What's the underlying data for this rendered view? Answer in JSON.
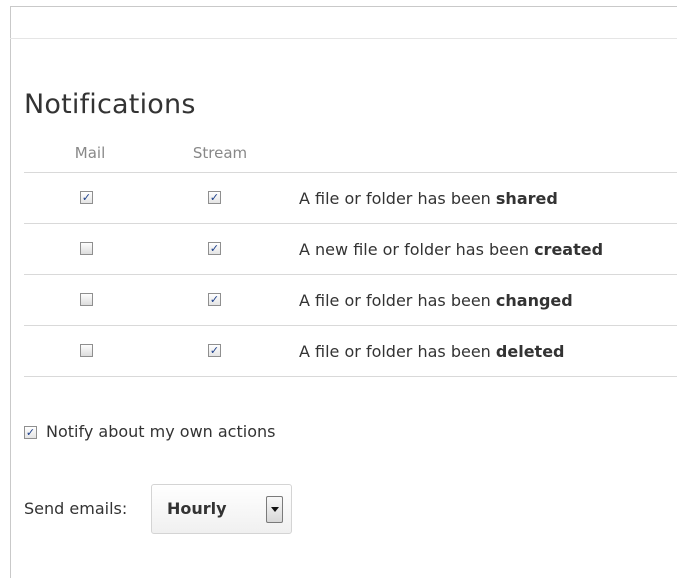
{
  "section": {
    "title": "Notifications",
    "columns": {
      "mail": "Mail",
      "stream": "Stream"
    }
  },
  "rows": [
    {
      "prefix": "A file or folder has been ",
      "emphasis": "shared",
      "mail": true,
      "stream": true
    },
    {
      "prefix": "A new file or folder has been ",
      "emphasis": "created",
      "mail": false,
      "stream": true
    },
    {
      "prefix": "A file or folder has been ",
      "emphasis": "changed",
      "mail": false,
      "stream": true
    },
    {
      "prefix": "A file or folder has been ",
      "emphasis": "deleted",
      "mail": false,
      "stream": true
    }
  ],
  "own_actions": {
    "label": "Notify about my own actions",
    "checked": true
  },
  "send_emails": {
    "label": "Send emails:",
    "value": "Hourly"
  },
  "icons": {
    "checkbox_tick": "checkmark-icon",
    "select_arrow": "chevron-down-icon"
  },
  "colors": {
    "tick": "#1c3f8a",
    "divider": "#d9d9d9",
    "muted": "#888888"
  }
}
